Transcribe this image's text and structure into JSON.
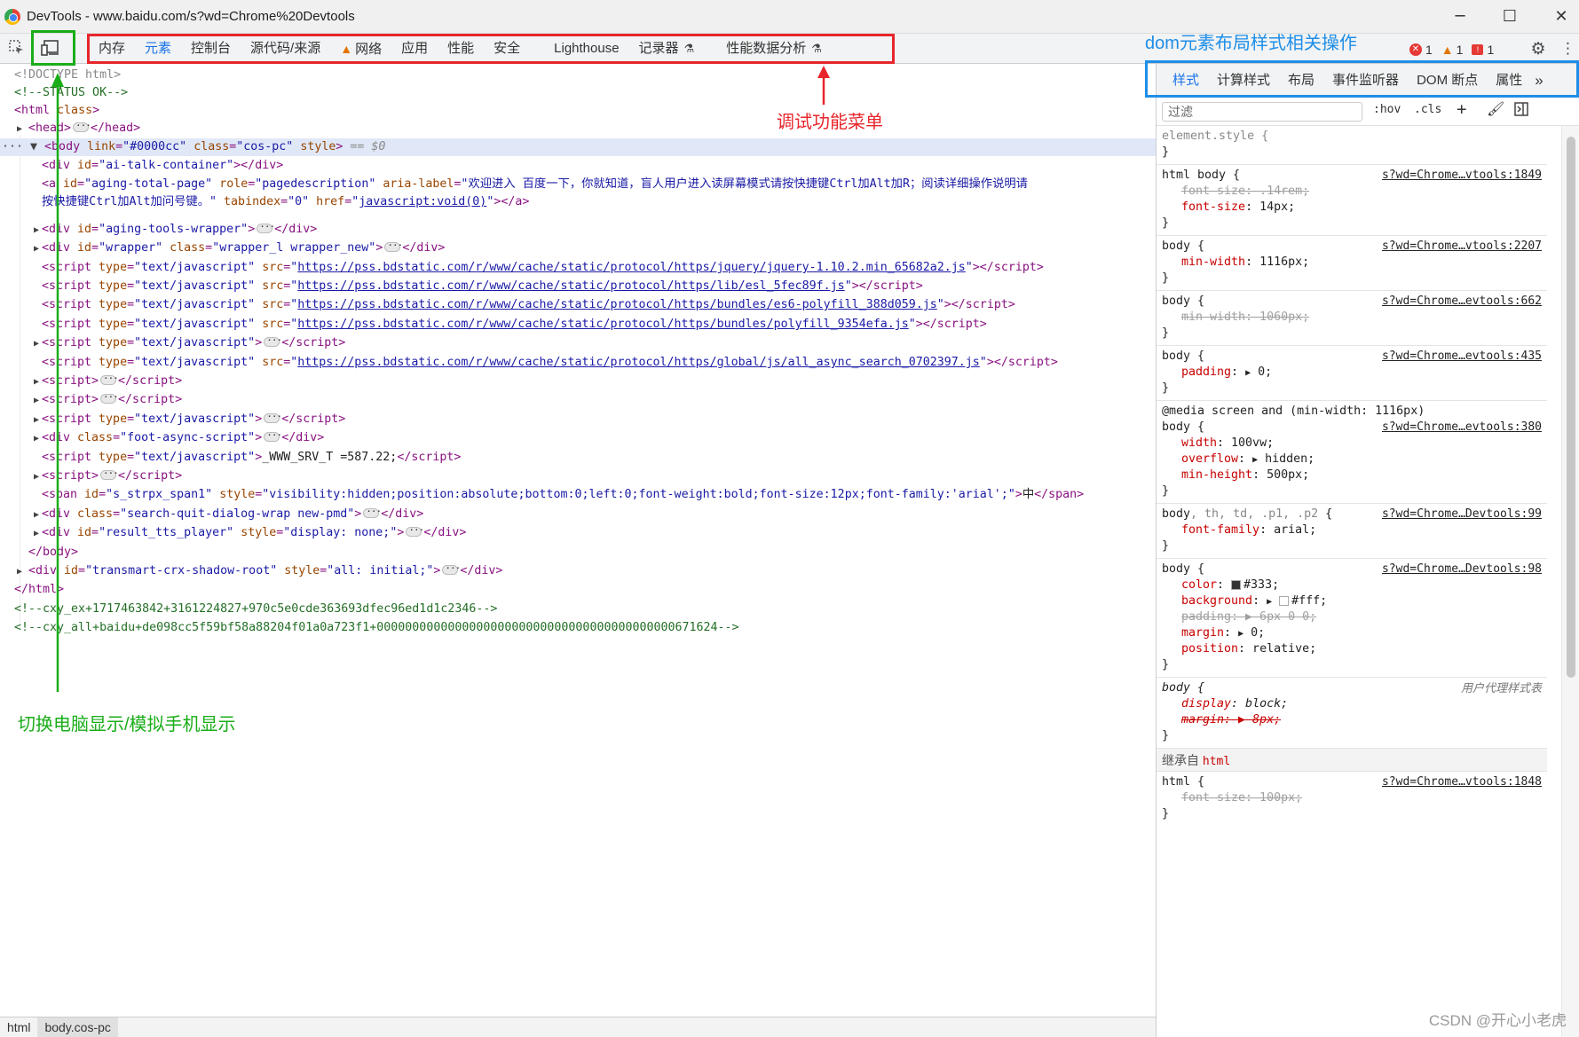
{
  "window": {
    "title": "DevTools - www.baidu.com/s?wd=Chrome%20Devtools",
    "minimize_icon": "minimize-icon",
    "maximize_icon": "maximize-icon",
    "close_icon": "close-icon"
  },
  "toolbar": {
    "inspect_icon": "inspect-element-icon",
    "device_icon": "device-toolbar-icon",
    "tabs": [
      "内存",
      "元素",
      "控制台",
      "源代码/来源",
      "网络",
      "应用",
      "性能",
      "安全",
      "Lighthouse",
      "记录器",
      "性能数据分析"
    ],
    "active_tab": "元素",
    "badges": {
      "errors": "1",
      "warnings": "1",
      "issues": "1"
    },
    "settings_icon": "gear-icon",
    "more_icon": "kebab-menu-icon"
  },
  "dom": {
    "doctype": "<!DOCTYPE html>",
    "status_comment": "<!--STATUS OK-->",
    "selected_marker": "== $0",
    "aria_label_1": "欢迎进入 百度一下，你就知道，盲人用户进入读屏幕模式请按快捷键Ctrl加Alt加R；阅读详细操作说明请",
    "aria_label_2": "按快捷键Ctrl加Alt加问号键。",
    "js_void": "javascript:void(0)",
    "src_jquery": "https://pss.bdstatic.com/r/www/cache/static/protocol/https/jquery/jquery-1.10.2.min_65682a2.js",
    "src_esl": "https://pss.bdstatic.com/r/www/cache/static/protocol/https/lib/esl_5fec89f.js",
    "src_es6": "https://pss.bdstatic.com/r/www/cache/static/protocol/https/bundles/es6-polyfill_388d059.js",
    "src_polyfill": "https://pss.bdstatic.com/r/www/cache/static/protocol/https/bundles/polyfill_9354efa.js",
    "src_async": "https://pss.bdstatic.com/r/www/cache/static/protocol/https/global/js/all_async_search_0702397.js",
    "srv_text": "_WWW_SRV_T =587.22;",
    "span_style": "visibility:hidden;position:absolute;bottom:0;left:0;font-weight:bold;font-size:12px;font-family:'arial';",
    "span_text": "中",
    "comment_ex": "<!--cxy_ex+1717463842+3161224827+970c5e0cde363693dfec96ed1d1c2346-->",
    "comment_all": "<!--cxy_all+baidu+de098cc5f59bf58a88204f01a0a723f1+000000000000000000000000000000000000000000671624-->"
  },
  "breadcrumb": [
    "html",
    "body.cos-pc"
  ],
  "styles": {
    "tabs": [
      "样式",
      "计算样式",
      "布局",
      "事件监听器",
      "DOM 断点",
      "属性"
    ],
    "active_tab": "样式",
    "more_tabs_icon": "double-chevron-right-icon",
    "filter_placeholder": "过滤",
    "hov": ":hov",
    "cls": ".cls",
    "add_rule_icon": "plus-icon",
    "paint_icon": "paint-brush-icon",
    "toggle_sidebar_icon": "sidebar-toggle-icon",
    "inherited_label": "继承自",
    "inherited_from": "html",
    "src_1849": "s?wd=Chrome…vtools:1849",
    "src_2207": "s?wd=Chrome…vtools:2207",
    "src_662": "s?wd=Chrome…evtools:662",
    "src_435": "s?wd=Chrome…evtools:435",
    "src_380": "s?wd=Chrome…evtools:380",
    "src_99": "s?wd=Chrome…Devtools:99",
    "src_98": "s?wd=Chrome…Devtools:98",
    "ua_label": "用户代理样式表",
    "src_1848": "s?wd=Chrome…vtools:1848",
    "media_query": "@media screen and (min-width: 1116px)"
  },
  "annotations": {
    "menu_label": "调试功能菜单",
    "dom_label": "dom元素布局样式相关操作",
    "device_label": "切换电脑显示/模拟手机显示",
    "red": "#e8252b",
    "green": "#1aad19",
    "blue": "#1e8ee8"
  },
  "watermark": "CSDN @开心小老虎"
}
